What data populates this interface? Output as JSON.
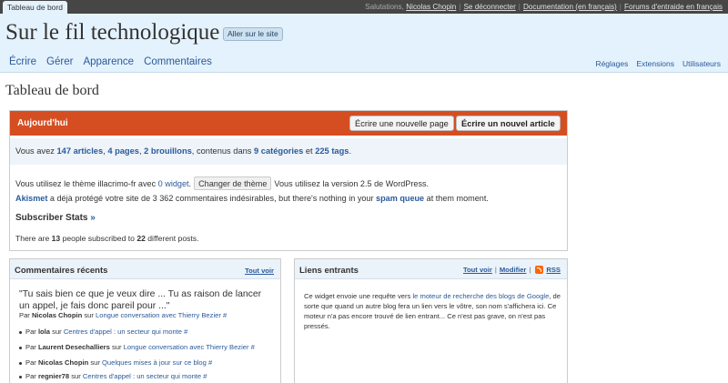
{
  "topbar": {
    "tab": "Tableau de bord",
    "greeting": "Salutations,",
    "user": "Nicolas Chopin",
    "logout": "Se déconnecter",
    "documentation": "Documentation (en français)",
    "forums": "Forums d'entraide en français"
  },
  "header": {
    "site_title": "Sur le fil technologique",
    "visit_site": "Aller sur le site",
    "menu": [
      "Écrire",
      "Gérer",
      "Apparence",
      "Commentaires"
    ],
    "sub_menu": [
      "Réglages",
      "Extensions",
      "Utilisateurs"
    ]
  },
  "page_title": "Tableau de bord",
  "today": {
    "title": "Aujourd'hui",
    "new_page": "Écrire une nouvelle page",
    "new_post": "Écrire un nouvel article",
    "stats": {
      "prefix": "Vous avez ",
      "articles": "147 articles",
      "sep1": ", ",
      "pages": "4 pages",
      "sep2": ", ",
      "drafts": "2 brouillons",
      "mid": ", contenus dans ",
      "categories": "9 catégories",
      "and": " et ",
      "tags": "225 tags",
      "end": "."
    },
    "theme": {
      "prefix": "Vous utilisez le thème illacrimo-fr avec ",
      "widgets": "0 widget",
      "end": ".",
      "change_button": "Changer de thème",
      "version": "Vous utilisez la version 2.5 de WordPress."
    },
    "akismet": {
      "name": "Akismet",
      "text": " a déjà protégé votre site de 3 362 commentaires indésirables, but there's nothing in your ",
      "spam_queue": "spam queue",
      "end": " at them moment."
    },
    "subscriber": {
      "title": "Subscriber Stats",
      "arrow": "»",
      "prefix": "There are ",
      "people": "13",
      "mid": " people subscribed to ",
      "posts": "22",
      "end": " different posts."
    }
  },
  "comments_widget": {
    "title": "Commentaires récents",
    "view_all": "Tout voir",
    "quote": "\"Tu sais bien ce que je veux dire ... Tu as raison de lancer un appel, je fais donc pareil pour ...\"",
    "meta": {
      "prefix": "Par ",
      "author": "Nicolas Chopin",
      "on": " sur ",
      "post": "Longue conversation avec Thierry Bezier",
      "hash": "#"
    },
    "items": [
      {
        "prefix": "Par ",
        "author": "lola",
        "on": " sur ",
        "post": "Centres d'appel : un secteur qui monte",
        "hash": "#"
      },
      {
        "prefix": "Par ",
        "author": "Laurent Desechalliers",
        "on": " sur ",
        "post": "Longue conversation avec Thierry Bezier",
        "hash": "#"
      },
      {
        "prefix": "Par ",
        "author": "Nicolas Chopin",
        "on": " sur ",
        "post": "Quelques mises à jour sur ce blog",
        "hash": "#"
      },
      {
        "prefix": "Par ",
        "author": "regnier78",
        "on": " sur ",
        "post": "Centres d'appel : un secteur qui monte",
        "hash": "#"
      }
    ]
  },
  "links_widget": {
    "title": "Liens entrants",
    "view_all": "Tout voir",
    "modify": "Modifier",
    "rss": "RSS",
    "text_prefix": "Ce widget envoie une requête vers ",
    "link": "le moteur de recherche des blogs de Google",
    "text_suffix": ", de sorte que quand un autre blog fera un lien vers le vôtre, son nom s'affichera ici. Ce moteur n'a pas encore trouvé de lien entrant... Ce n'est pas grave, on n'est pas pressés."
  }
}
